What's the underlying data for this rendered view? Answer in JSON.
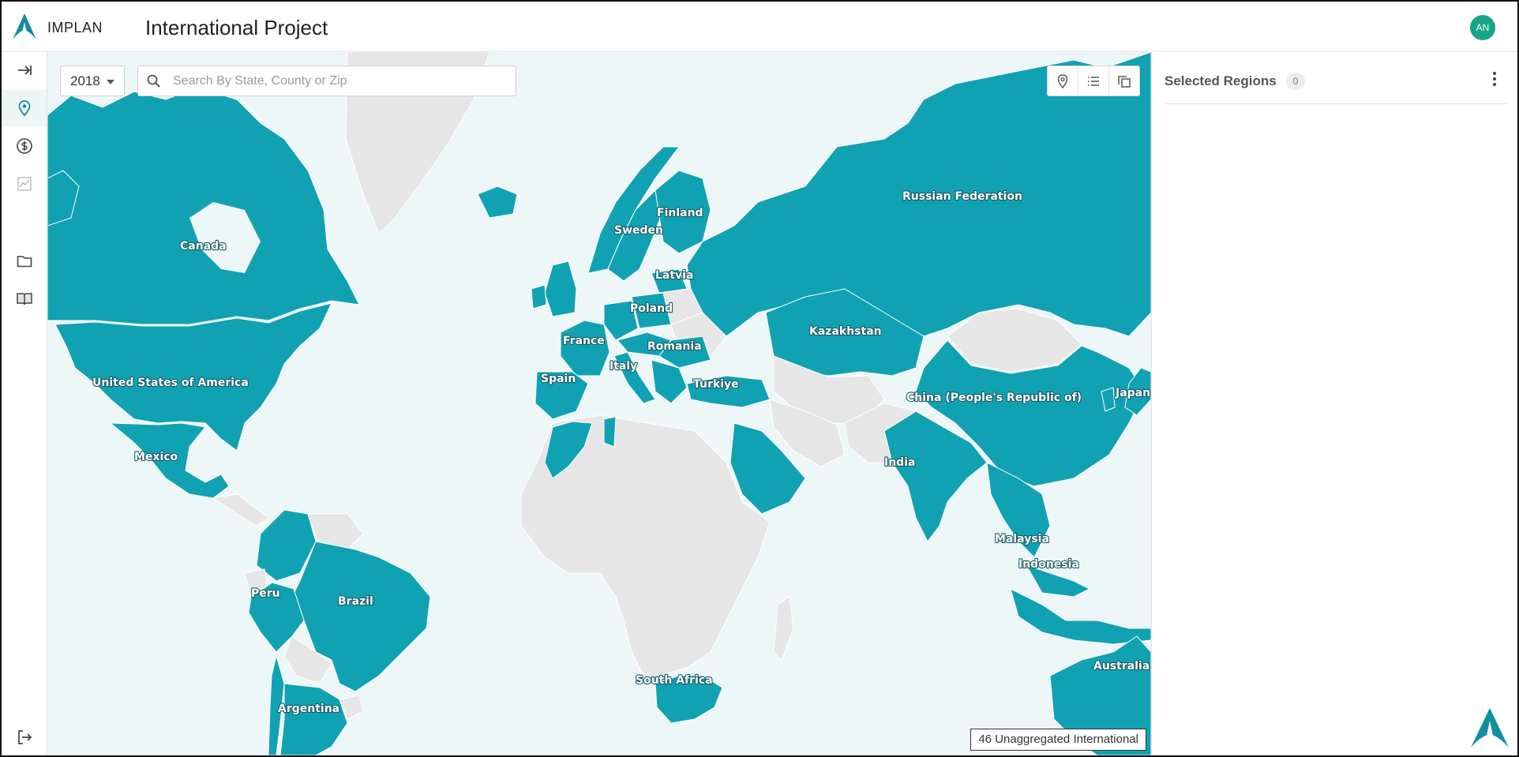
{
  "header": {
    "logo_text": "IMPLAN",
    "title": "International Project",
    "user_initials": "AN"
  },
  "rail": {
    "items": [
      {
        "icon": "expand-arrow-icon"
      },
      {
        "icon": "location-pin-icon",
        "active": true
      },
      {
        "icon": "dollar-circle-icon"
      },
      {
        "icon": "chart-icon",
        "disabled": true
      },
      {
        "icon": "folder-icon"
      },
      {
        "icon": "book-icon"
      },
      {
        "icon": "logout-icon"
      }
    ]
  },
  "map": {
    "year_value": "2018",
    "search_placeholder": "Search By State, County or Zip",
    "tools": [
      "pin-icon",
      "list-icon",
      "copy-icon"
    ],
    "status_text": "46 Unaggregated International",
    "colors": {
      "ocean": "#eef7f8",
      "selected_country": "#10a2b3",
      "unselected_country": "#e6e6e6",
      "border": "#ffffff"
    },
    "labels": {
      "canada": "Canada",
      "usa": "United States of America",
      "mexico": "Mexico",
      "peru": "Peru",
      "brazil": "Brazil",
      "argentina": "Argentina",
      "finland": "Finland",
      "sweden": "Sweden",
      "latvia": "Latvia",
      "poland": "Poland",
      "france": "France",
      "romania": "Romania",
      "italy": "Italy",
      "spain": "Spain",
      "turkiye": "Turkiye",
      "russia": "Russian Federation",
      "kazakhstan": "Kazakhstan",
      "china": "China (People's Republic of)",
      "japan": "Japan",
      "india": "India",
      "malaysia": "Malaysia",
      "indonesia": "Indonesia",
      "south_africa": "South Africa",
      "australia": "Australia"
    }
  },
  "panel": {
    "title": "Selected Regions",
    "count": "0"
  }
}
